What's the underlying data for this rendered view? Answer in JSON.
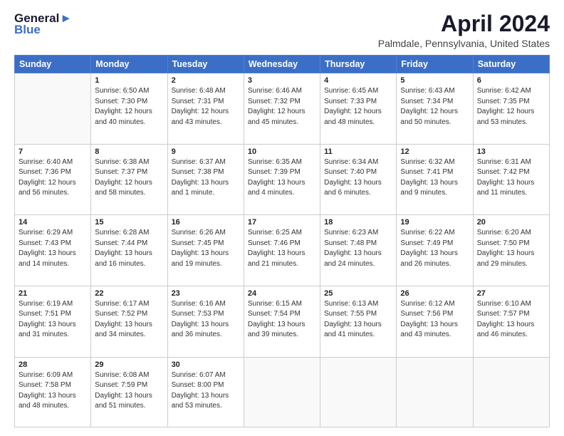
{
  "header": {
    "logo_general": "General",
    "logo_blue": "Blue",
    "month_title": "April 2024",
    "location": "Palmdale, Pennsylvania, United States"
  },
  "days_of_week": [
    "Sunday",
    "Monday",
    "Tuesday",
    "Wednesday",
    "Thursday",
    "Friday",
    "Saturday"
  ],
  "weeks": [
    [
      {
        "day": "",
        "empty": true
      },
      {
        "day": "1",
        "sunrise": "6:50 AM",
        "sunset": "7:30 PM",
        "daylight": "12 hours and 40 minutes."
      },
      {
        "day": "2",
        "sunrise": "6:48 AM",
        "sunset": "7:31 PM",
        "daylight": "12 hours and 43 minutes."
      },
      {
        "day": "3",
        "sunrise": "6:46 AM",
        "sunset": "7:32 PM",
        "daylight": "12 hours and 45 minutes."
      },
      {
        "day": "4",
        "sunrise": "6:45 AM",
        "sunset": "7:33 PM",
        "daylight": "12 hours and 48 minutes."
      },
      {
        "day": "5",
        "sunrise": "6:43 AM",
        "sunset": "7:34 PM",
        "daylight": "12 hours and 50 minutes."
      },
      {
        "day": "6",
        "sunrise": "6:42 AM",
        "sunset": "7:35 PM",
        "daylight": "12 hours and 53 minutes."
      }
    ],
    [
      {
        "day": "7",
        "sunrise": "6:40 AM",
        "sunset": "7:36 PM",
        "daylight": "12 hours and 56 minutes."
      },
      {
        "day": "8",
        "sunrise": "6:38 AM",
        "sunset": "7:37 PM",
        "daylight": "12 hours and 58 minutes."
      },
      {
        "day": "9",
        "sunrise": "6:37 AM",
        "sunset": "7:38 PM",
        "daylight": "13 hours and 1 minute."
      },
      {
        "day": "10",
        "sunrise": "6:35 AM",
        "sunset": "7:39 PM",
        "daylight": "13 hours and 4 minutes."
      },
      {
        "day": "11",
        "sunrise": "6:34 AM",
        "sunset": "7:40 PM",
        "daylight": "13 hours and 6 minutes."
      },
      {
        "day": "12",
        "sunrise": "6:32 AM",
        "sunset": "7:41 PM",
        "daylight": "13 hours and 9 minutes."
      },
      {
        "day": "13",
        "sunrise": "6:31 AM",
        "sunset": "7:42 PM",
        "daylight": "13 hours and 11 minutes."
      }
    ],
    [
      {
        "day": "14",
        "sunrise": "6:29 AM",
        "sunset": "7:43 PM",
        "daylight": "13 hours and 14 minutes."
      },
      {
        "day": "15",
        "sunrise": "6:28 AM",
        "sunset": "7:44 PM",
        "daylight": "13 hours and 16 minutes."
      },
      {
        "day": "16",
        "sunrise": "6:26 AM",
        "sunset": "7:45 PM",
        "daylight": "13 hours and 19 minutes."
      },
      {
        "day": "17",
        "sunrise": "6:25 AM",
        "sunset": "7:46 PM",
        "daylight": "13 hours and 21 minutes."
      },
      {
        "day": "18",
        "sunrise": "6:23 AM",
        "sunset": "7:48 PM",
        "daylight": "13 hours and 24 minutes."
      },
      {
        "day": "19",
        "sunrise": "6:22 AM",
        "sunset": "7:49 PM",
        "daylight": "13 hours and 26 minutes."
      },
      {
        "day": "20",
        "sunrise": "6:20 AM",
        "sunset": "7:50 PM",
        "daylight": "13 hours and 29 minutes."
      }
    ],
    [
      {
        "day": "21",
        "sunrise": "6:19 AM",
        "sunset": "7:51 PM",
        "daylight": "13 hours and 31 minutes."
      },
      {
        "day": "22",
        "sunrise": "6:17 AM",
        "sunset": "7:52 PM",
        "daylight": "13 hours and 34 minutes."
      },
      {
        "day": "23",
        "sunrise": "6:16 AM",
        "sunset": "7:53 PM",
        "daylight": "13 hours and 36 minutes."
      },
      {
        "day": "24",
        "sunrise": "6:15 AM",
        "sunset": "7:54 PM",
        "daylight": "13 hours and 39 minutes."
      },
      {
        "day": "25",
        "sunrise": "6:13 AM",
        "sunset": "7:55 PM",
        "daylight": "13 hours and 41 minutes."
      },
      {
        "day": "26",
        "sunrise": "6:12 AM",
        "sunset": "7:56 PM",
        "daylight": "13 hours and 43 minutes."
      },
      {
        "day": "27",
        "sunrise": "6:10 AM",
        "sunset": "7:57 PM",
        "daylight": "13 hours and 46 minutes."
      }
    ],
    [
      {
        "day": "28",
        "sunrise": "6:09 AM",
        "sunset": "7:58 PM",
        "daylight": "13 hours and 48 minutes."
      },
      {
        "day": "29",
        "sunrise": "6:08 AM",
        "sunset": "7:59 PM",
        "daylight": "13 hours and 51 minutes."
      },
      {
        "day": "30",
        "sunrise": "6:07 AM",
        "sunset": "8:00 PM",
        "daylight": "13 hours and 53 minutes."
      },
      {
        "day": "",
        "empty": true
      },
      {
        "day": "",
        "empty": true
      },
      {
        "day": "",
        "empty": true
      },
      {
        "day": "",
        "empty": true
      }
    ]
  ],
  "labels": {
    "sunrise": "Sunrise:",
    "sunset": "Sunset:",
    "daylight": "Daylight:"
  }
}
